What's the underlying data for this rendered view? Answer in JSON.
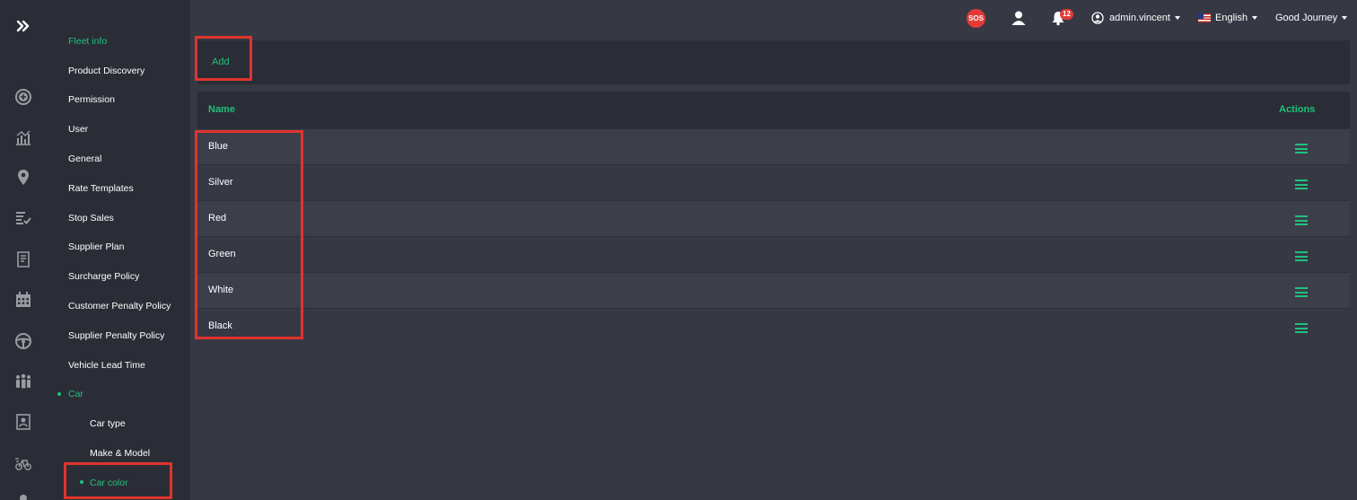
{
  "rail": {
    "icons": [
      "expand-icon",
      "add-circle-icon",
      "analytics-icon",
      "location-icon",
      "checklist-icon",
      "receipt-icon",
      "calendar-icon",
      "steering-wheel-icon",
      "group-icon",
      "contact-card-icon",
      "bike-icon"
    ]
  },
  "sidebar": {
    "items": [
      {
        "label": "Fleet info",
        "active": true
      },
      {
        "label": "Product Discovery"
      },
      {
        "label": "Permission"
      },
      {
        "label": "User"
      },
      {
        "label": "General"
      },
      {
        "label": "Rate Templates"
      },
      {
        "label": "Stop Sales"
      },
      {
        "label": "Supplier Plan"
      },
      {
        "label": "Surcharge Policy"
      },
      {
        "label": "Customer Penalty Policy"
      },
      {
        "label": "Supplier Penalty Policy"
      },
      {
        "label": "Vehicle Lead Time"
      },
      {
        "label": "Car",
        "active": true
      }
    ],
    "sub_items": [
      {
        "label": "Car type"
      },
      {
        "label": "Make & Model"
      },
      {
        "label": "Car color",
        "active": true
      }
    ]
  },
  "topbar": {
    "sos_label": "SOS",
    "notification_count": "12",
    "username": "admin.vincent",
    "language": "English",
    "company": "Good Journey"
  },
  "toolbar": {
    "add_label": "Add"
  },
  "table": {
    "columns": [
      "Name",
      "Actions"
    ],
    "rows": [
      "Blue",
      "Silver",
      "Red",
      "Green",
      "White",
      "Black"
    ]
  },
  "colors": {
    "accent": "#21c07d",
    "highlight": "#e0342d",
    "panel": "#2a2d35",
    "background": "#363944"
  }
}
